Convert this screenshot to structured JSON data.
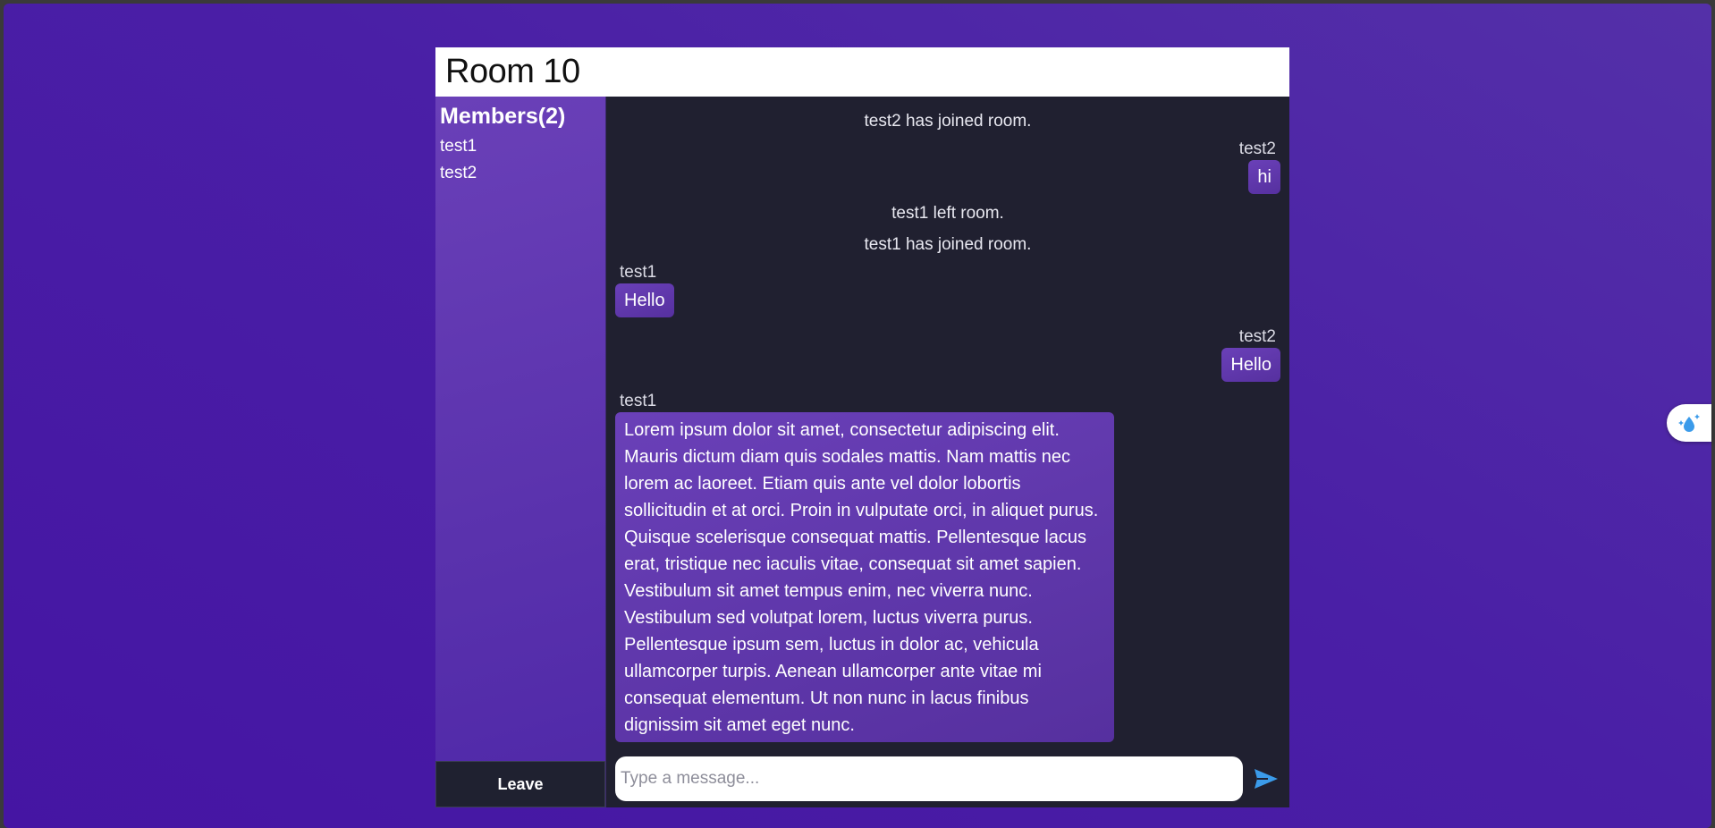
{
  "room": {
    "title": "Room 10"
  },
  "sidebar": {
    "members_title": "Members(2)",
    "members": [
      "test1",
      "test2"
    ],
    "leave_label": "Leave"
  },
  "messages": [
    {
      "type": "system",
      "text": "test2 has joined room."
    },
    {
      "type": "chat",
      "side": "right",
      "sender": "test2",
      "text": "hi"
    },
    {
      "type": "system",
      "text": "test1 left room."
    },
    {
      "type": "system",
      "text": "test1 has joined room."
    },
    {
      "type": "chat",
      "side": "left",
      "sender": "test1",
      "text": "Hello"
    },
    {
      "type": "chat",
      "side": "right",
      "sender": "test2",
      "text": "Hello"
    },
    {
      "type": "chat",
      "side": "left",
      "sender": "test1",
      "text": "Lorem ipsum dolor sit amet, consectetur adipiscing elit. Mauris dictum diam quis sodales mattis. Nam mattis nec lorem ac laoreet. Etiam quis ante vel dolor lobortis sollicitudin et at orci. Proin in vulputate orci, in aliquet purus. Quisque scelerisque consequat mattis. Pellentesque lacus erat, tristique nec iaculis vitae, consequat sit amet sapien. Vestibulum sit amet tempus enim, nec viverra nunc. Vestibulum sed volutpat lorem, luctus viverra purus. Pellentesque ipsum sem, luctus in dolor ac, vehicula ullamcorper turpis. Aenean ullamcorper ante vitae mi consequat elementum. Ut non nunc in lacus finibus dignissim sit amet eget nunc."
    }
  ],
  "composer": {
    "placeholder": "Type a message...",
    "value": "",
    "send_icon": "send-icon"
  },
  "extension": {
    "icon": "sparkle-drop-icon"
  },
  "colors": {
    "accent": "#5a32ad",
    "background": "#4a1fa6",
    "chat_bg": "#202030",
    "send": "#3b9bea"
  }
}
